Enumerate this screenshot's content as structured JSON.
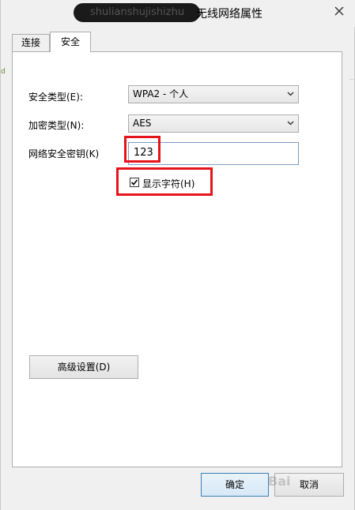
{
  "window": {
    "title_obscured": "shulianshujishizhu",
    "title": "无线网络属性"
  },
  "tabs": [
    {
      "label": "连接"
    },
    {
      "label": "安全"
    }
  ],
  "left_marker": "d",
  "security": {
    "type_label": "安全类型(E):",
    "type_value": "WPA2 - 个人",
    "encryption_label": "加密类型(N):",
    "encryption_value": "AES",
    "key_label": "网络安全密钥(K)",
    "key_value": "123",
    "show_chars_label": "显示字符(H)",
    "show_chars_checked": true,
    "advanced_button": "高级设置(D)"
  },
  "footer": {
    "ok_button": "确定",
    "cancel_button": "取消"
  },
  "watermark": "Bai",
  "colors": {
    "highlight": "#e5141a",
    "accent": "#3c7fb1"
  }
}
